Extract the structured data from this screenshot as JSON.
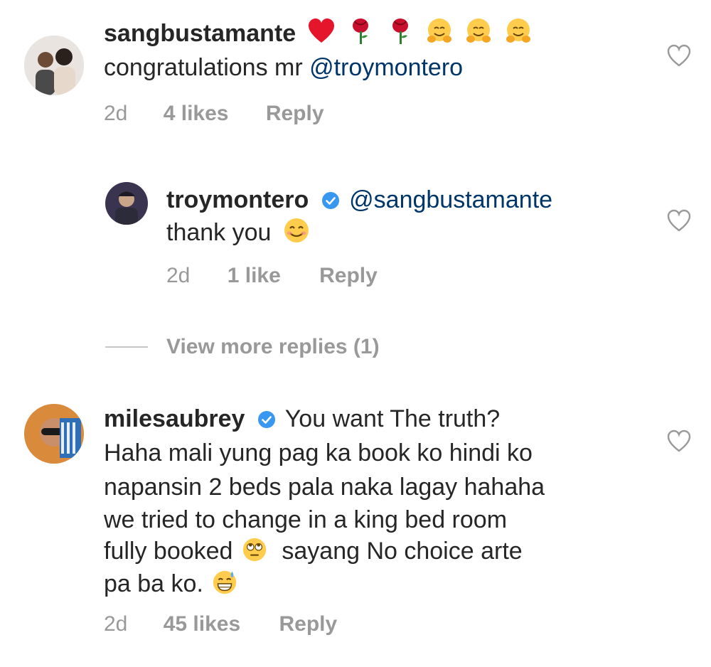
{
  "comments": [
    {
      "username": "sangbustamante",
      "verified": false,
      "lines": [
        "congratulations mr "
      ],
      "mention": "@troymontero",
      "time": "2d",
      "likes": "4 likes",
      "reply": "Reply",
      "emojis": [
        "red-heart",
        "rose",
        "rose",
        "hugging-face",
        "hugging-face",
        "hugging-face"
      ]
    },
    {
      "username": "troymontero",
      "verified": true,
      "mention": "@sangbustamante",
      "lines": [
        "thank you"
      ],
      "time": "2d",
      "likes": "1 like",
      "reply": "Reply",
      "emojis": [
        "smiling-face"
      ]
    },
    {
      "username": "milesaubrey",
      "verified": true,
      "lines": [
        "You want The truth?",
        "Haha mali yung pag ka book ko hindi ko",
        "napansin 2 beds pala naka lagay hahaha",
        "we tried to change in a king bed room",
        "fully booked",
        "sayang No choice arte",
        "pa ba ko."
      ],
      "time": "2d",
      "likes": "45 likes",
      "reply": "Reply",
      "emojis": [
        "rolling-eyes-face",
        "grinning-sweat-face"
      ]
    }
  ],
  "view_more": "View more replies (1)",
  "colors": {
    "text": "#262626",
    "mention": "#003569",
    "meta": "#999999",
    "verified": "#3897f0",
    "heart_outline": "#999999"
  }
}
